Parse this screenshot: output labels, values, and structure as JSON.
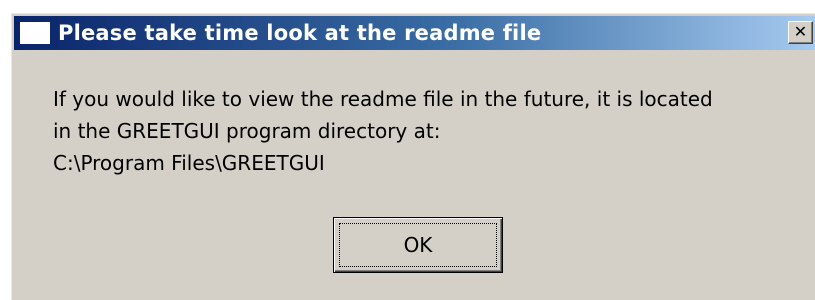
{
  "window": {
    "title": "Please take time look at the readme file",
    "close_glyph": "✕"
  },
  "message": {
    "line1": "If you would like to view the readme file in the future, it is located",
    "line2": "in the GREETGUI program directory at:",
    "line3": "C:\\Program Files\\GREETGUI"
  },
  "buttons": {
    "ok_label": "OK"
  },
  "icons": {
    "app": "window-icon",
    "close": "close-icon"
  },
  "colors": {
    "titlebar_start": "#0a246a",
    "titlebar_end": "#a6caf0",
    "dialog_bg": "#d4d0c8"
  }
}
